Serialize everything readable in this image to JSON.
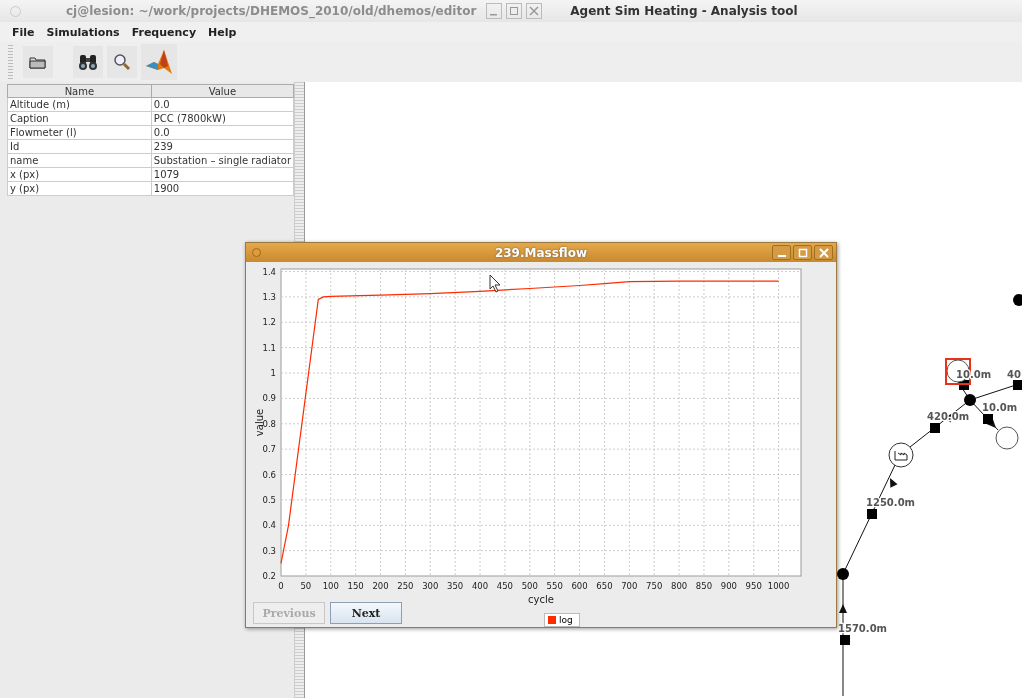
{
  "title_bar": {
    "background_title": "cj@lesion: ~/work/projects/DHEMOS_2010/old/dhemos/editor",
    "title": "Agent Sim Heating - Analysis tool"
  },
  "menu": [
    {
      "label": "File"
    },
    {
      "label": "Simulations"
    },
    {
      "label": "Frequency"
    },
    {
      "label": "Help"
    }
  ],
  "properties": {
    "columns": [
      "Name",
      "Value"
    ],
    "rows": [
      [
        "Altitude (m)",
        "0.0"
      ],
      [
        "Caption",
        "PCC (7800kW)"
      ],
      [
        "Flowmeter (l)",
        "0.0"
      ],
      [
        "Id",
        "239"
      ],
      [
        "name",
        "Substation – single radiator"
      ],
      [
        "x (px)",
        "1079"
      ],
      [
        "y (px)",
        "1900"
      ]
    ]
  },
  "network": {
    "nodes": [
      {
        "kind": "junction",
        "selected": false
      },
      {
        "kind": "consumer",
        "selected": true
      },
      {
        "kind": "junction",
        "selected": false
      },
      {
        "kind": "consumer",
        "selected": false
      },
      {
        "kind": "plant",
        "selected": false
      },
      {
        "kind": "junction",
        "selected": false
      }
    ],
    "edge_labels": [
      "10.0m",
      "40",
      "10.0m",
      "420.0m",
      "1250.0m",
      "1570.0m"
    ]
  },
  "chart_window": {
    "title": "239.Massflow",
    "chart_data": {
      "type": "line",
      "xlabel": "cycle",
      "ylabel": "value",
      "x": [
        0,
        15,
        75,
        85,
        100,
        200,
        300,
        400,
        500,
        600,
        650,
        700,
        800,
        900,
        1000
      ],
      "series": [
        {
          "name": "log",
          "color": "#ff2a00",
          "values": [
            0.25,
            0.4,
            1.29,
            1.3,
            1.302,
            1.307,
            1.313,
            1.322,
            1.333,
            1.345,
            1.352,
            1.36,
            1.362,
            1.362,
            1.362
          ]
        }
      ],
      "grid": true,
      "xlim": [
        0,
        1045
      ],
      "ylim": [
        0.2,
        1.41
      ],
      "xticks": [
        0,
        50,
        100,
        150,
        200,
        250,
        300,
        350,
        400,
        450,
        500,
        550,
        600,
        650,
        700,
        750,
        800,
        850,
        900,
        950,
        1000
      ],
      "yticks": [
        0.2,
        0.3,
        0.4,
        0.5,
        0.6,
        0.7,
        0.8,
        0.9,
        1,
        1.1,
        1.2,
        1.3,
        1.4
      ]
    },
    "buttons": [
      {
        "label": "Previous",
        "disabled": true
      },
      {
        "label": "Next",
        "disabled": false
      }
    ]
  }
}
